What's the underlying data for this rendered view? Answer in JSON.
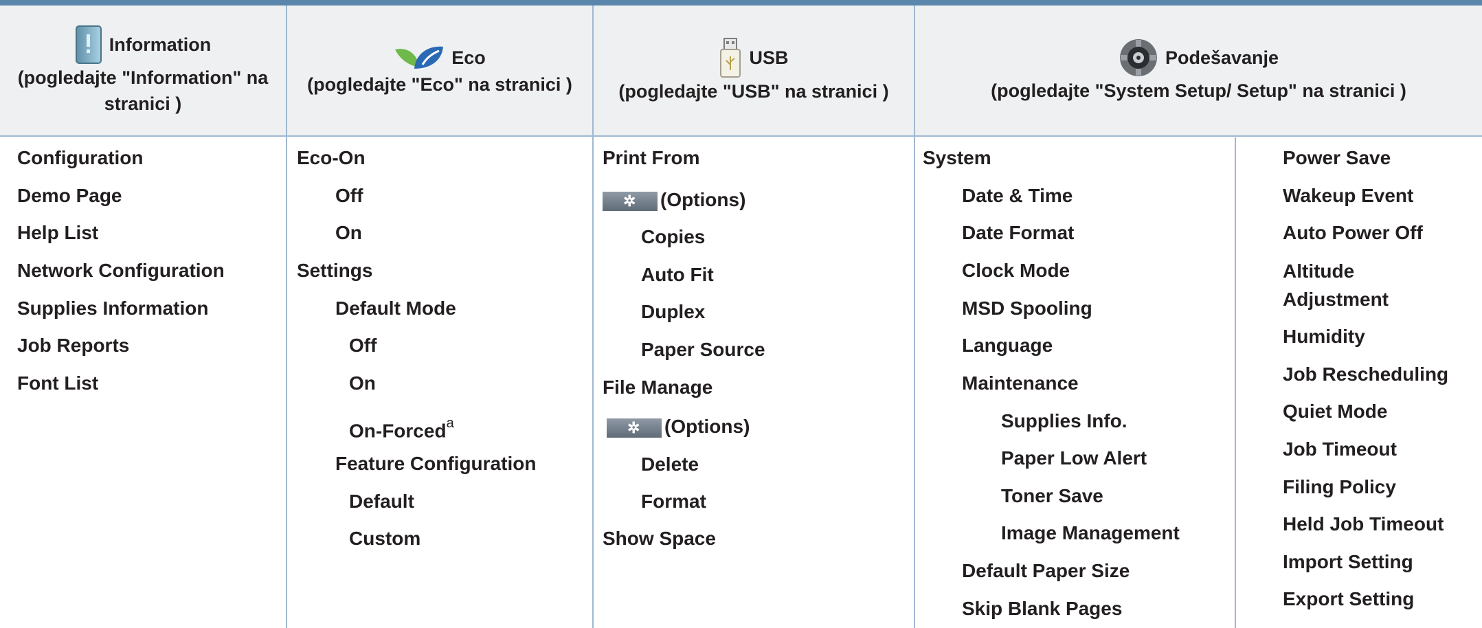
{
  "headers": {
    "information": {
      "title": "Information",
      "sub": "(pogledajte \"Information\" na stranici )",
      "icon": "information-book-icon"
    },
    "eco": {
      "title": "Eco",
      "sub": "(pogledajte \"Eco\" na stranici )",
      "icon": "eco-leaf-icon"
    },
    "usb": {
      "title": "USB",
      "sub": "(pogledajte \"USB\" na stranici )",
      "icon": "usb-drive-icon"
    },
    "setup": {
      "title": "Podešavanje",
      "sub": "(pogledajte \"System Setup/ Setup\" na stranici )",
      "icon": "gear-icon"
    }
  },
  "information_items": [
    "Configuration",
    "Demo Page",
    "Help List",
    "Network Configuration",
    "Supplies Information",
    "Job Reports",
    "Font List"
  ],
  "eco_items": [
    "Eco-On",
    "Off",
    "On",
    "Settings",
    "Default Mode",
    "Off",
    "On",
    "On-Forced",
    "Feature Configuration",
    "Default",
    "Custom"
  ],
  "eco_footnote_mark": "a",
  "usb_items": [
    "Print From",
    "(Options)",
    "Copies",
    "Auto Fit",
    "Duplex",
    "Paper Source",
    "File Manage",
    "(Options)",
    "Delete",
    "Format",
    "Show Space"
  ],
  "system_items": [
    "System",
    "Date & Time",
    "Date Format",
    "Clock Mode",
    "MSD Spooling",
    "Language",
    "Maintenance",
    "Supplies Info.",
    "Paper Low Alert",
    "Toner Save",
    "Image Management",
    "Default Paper Size",
    "Skip Blank Pages"
  ],
  "system_right_items": [
    "Power Save",
    "Wakeup Event",
    "Auto Power Off",
    "Altitude Adjustment",
    "Humidity",
    "Job Rescheduling",
    "Quiet Mode",
    "Job Timeout",
    "Filing Policy",
    "Held Job Timeout",
    "Import Setting",
    "Export Setting"
  ],
  "options_button_glyph": "✲",
  "colors": {
    "top_bar": "#5b86ac",
    "header_bg": "#eef0f2",
    "grid_line": "#9fb8d0"
  }
}
